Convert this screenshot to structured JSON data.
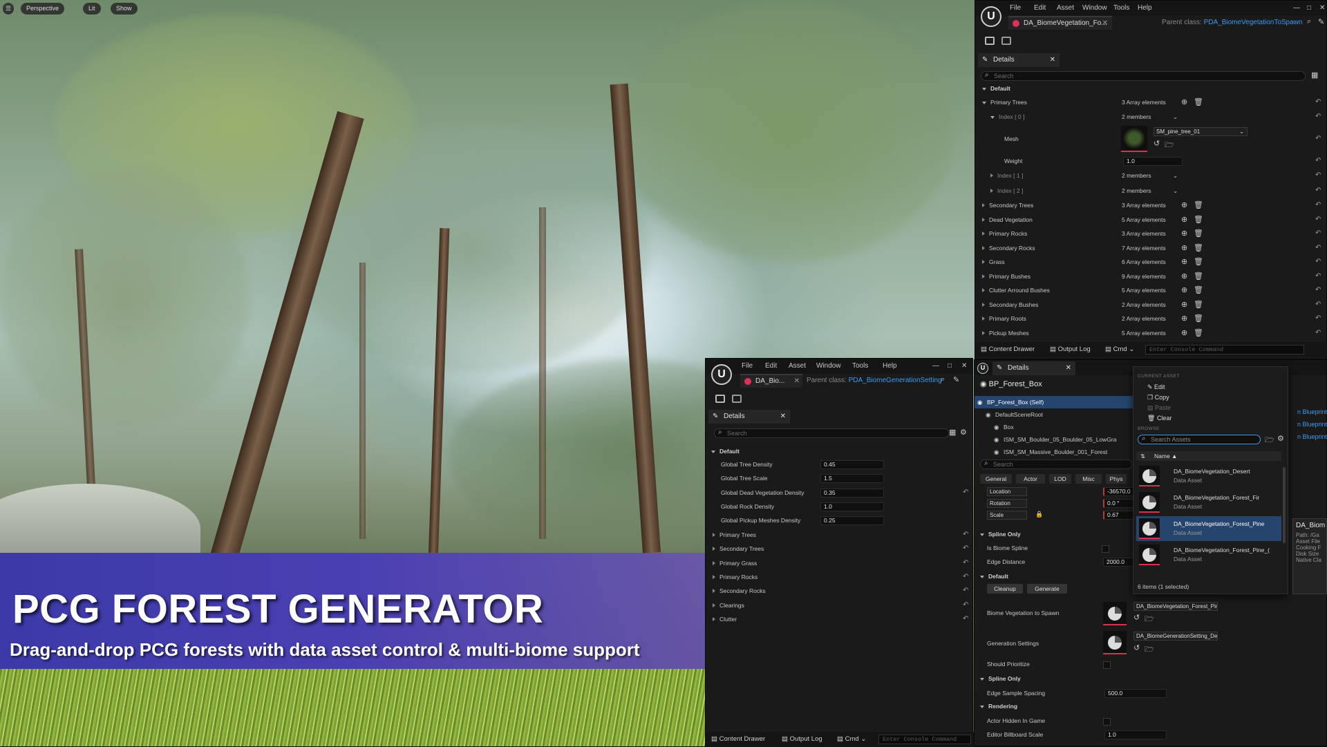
{
  "viewport": {
    "buttons": [
      "Perspective",
      "Lit",
      "Show"
    ],
    "banner_title": "PCG FOREST GENERATOR",
    "banner_subtitle": "Drag-and-drop PCG forests with data asset control & multi-biome support"
  },
  "win_top": {
    "menu": [
      "File",
      "Edit",
      "Asset",
      "Window",
      "Tools",
      "Help"
    ],
    "tab_label": "DA_BiomeVegetation_Fo...",
    "parent_label": "Parent class:",
    "parent_value": "PDA_BiomeVegetationToSpawn",
    "details_tab": "Details",
    "search_placeholder": "Search",
    "category": "Default",
    "primary_trees": {
      "label": "Primary Trees",
      "value": "3 Array elements"
    },
    "index0": {
      "label": "Index [ 0 ]",
      "value": "2 members"
    },
    "mesh": {
      "label": "Mesh",
      "value": "SM_pine_tree_01"
    },
    "weight": {
      "label": "Weight",
      "value": "1.0"
    },
    "index1": {
      "label": "Index [ 1 ]",
      "value": "2 members"
    },
    "index2": {
      "label": "Index [ 2 ]",
      "value": "2 members"
    },
    "arrays": [
      {
        "label": "Secondary Trees",
        "value": "3 Array elements"
      },
      {
        "label": "Dead Vegetation",
        "value": "5 Array elements"
      },
      {
        "label": "Primary Rocks",
        "value": "3 Array elements"
      },
      {
        "label": "Secondary Rocks",
        "value": "7 Array elements"
      },
      {
        "label": "Grass",
        "value": "6 Array elements"
      },
      {
        "label": "Primary Bushes",
        "value": "9 Array elements"
      },
      {
        "label": "Clutter Arround Bushes",
        "value": "5 Array elements"
      },
      {
        "label": "Secondary Bushes",
        "value": "2 Array elements"
      },
      {
        "label": "Primary Roots",
        "value": "2 Array elements"
      },
      {
        "label": "Pickup Meshes",
        "value": "5 Array elements"
      }
    ],
    "bottom": {
      "content_drawer": "Content Drawer",
      "output_log": "Output Log",
      "cmd": "Cmd",
      "console": "Enter Console Command"
    }
  },
  "win_mid": {
    "menu": [
      "File",
      "Edit",
      "Asset",
      "Window",
      "Tools",
      "Help"
    ],
    "tab_label": "DA_Bio...",
    "parent_label": "Parent class:",
    "parent_value": "PDA_BiomeGenerationSetting",
    "details_tab": "Details",
    "search_placeholder": "Search",
    "category": "Default",
    "props": [
      {
        "label": "Global Tree Density",
        "value": "0.45"
      },
      {
        "label": "Global Tree Scale",
        "value": "1.5"
      },
      {
        "label": "Global Dead Vegetation Density",
        "value": "0.35"
      },
      {
        "label": "Global Rock Density",
        "value": "1.0"
      },
      {
        "label": "Global Pickup Meshes Density",
        "value": "0.25"
      }
    ],
    "groups": [
      "Primary Trees",
      "Secondary Trees",
      "Primary Grass",
      "Primary Rocks",
      "Secondary Rocks",
      "Clearings",
      "Clutter"
    ],
    "bottom": {
      "content_drawer": "Content Drawer",
      "output_log": "Output Log",
      "cmd": "Cmd",
      "console": "Enter Console Command"
    }
  },
  "win_right": {
    "details_tab": "Details",
    "actor": "BP_Forest_Box",
    "tree": [
      {
        "label": "BP_Forest_Box (Self)"
      },
      {
        "label": "DefaultSceneRoot"
      },
      {
        "label": "Box"
      },
      {
        "label": "ISM_SM_Boulder_05_Boulder_05_LowGra"
      },
      {
        "label": "ISM_SM_Massive_Boulder_001_Forest"
      }
    ],
    "blueprint_links": [
      "n Blueprint",
      "n Blueprint",
      "n Blueprint"
    ],
    "search_placeholder": "Search",
    "filters": [
      "General",
      "Actor",
      "LOD",
      "Misc",
      "Phys"
    ],
    "transform": [
      {
        "label": "Location",
        "value": "-36570.0"
      },
      {
        "label": "Rotation",
        "value": "0.0 °"
      },
      {
        "label": "Scale",
        "value": "0.67"
      }
    ],
    "spline_only": "Spline Only",
    "is_biome_spline": "Is Biome Spline",
    "edge_distance": {
      "label": "Edge Distance",
      "value": "2000.0"
    },
    "default": "Default",
    "buttons": [
      "Cleanup",
      "Generate"
    ],
    "biome_veg": {
      "label": "Biome Vegetation to Spawn",
      "value": "DA_BiomeVegetation_Forest_Pine"
    },
    "gen_settings": {
      "label": "Generation Settings",
      "value": "DA_BiomeGenerationSetting_Dense"
    },
    "should_prioritize": "Should Prioritize",
    "spline_only2": "Spline Only",
    "edge_sample": {
      "label": "Edge Sample Spacing",
      "value": "500.0"
    },
    "rendering": "Rendering",
    "actor_hidden": "Actor Hidden In Game",
    "billboard": {
      "label": "Editor Billboard Scale",
      "value": "1.0"
    }
  },
  "picker": {
    "current_asset": "CURRENT ASSET",
    "actions": [
      "Edit",
      "Copy",
      "Paste",
      "Clear"
    ],
    "browse": "BROWSE",
    "search_placeholder": "Search Assets",
    "name_header": "Name",
    "assets": [
      {
        "name": "DA_BiomeVegetation_Desert",
        "type": "Data Asset"
      },
      {
        "name": "DA_BiomeVegetation_Forest_Fir",
        "type": "Data Asset"
      },
      {
        "name": "DA_BiomeVegetation_Forest_Pine",
        "type": "Data Asset"
      },
      {
        "name": "DA_BiomeVegetation_Forest_Pine_(",
        "type": "Data Asset"
      }
    ],
    "footer": "6 items (1 selected)",
    "tooltip": [
      "DA_Biom",
      "Path: /Ga",
      "Asset File",
      "Cooking F",
      "Disk Size",
      "Native Cla"
    ]
  },
  "colors": {
    "accent_blue": "#3b9cf0",
    "selection": "#26456e",
    "asset_red": "#e0305a"
  }
}
